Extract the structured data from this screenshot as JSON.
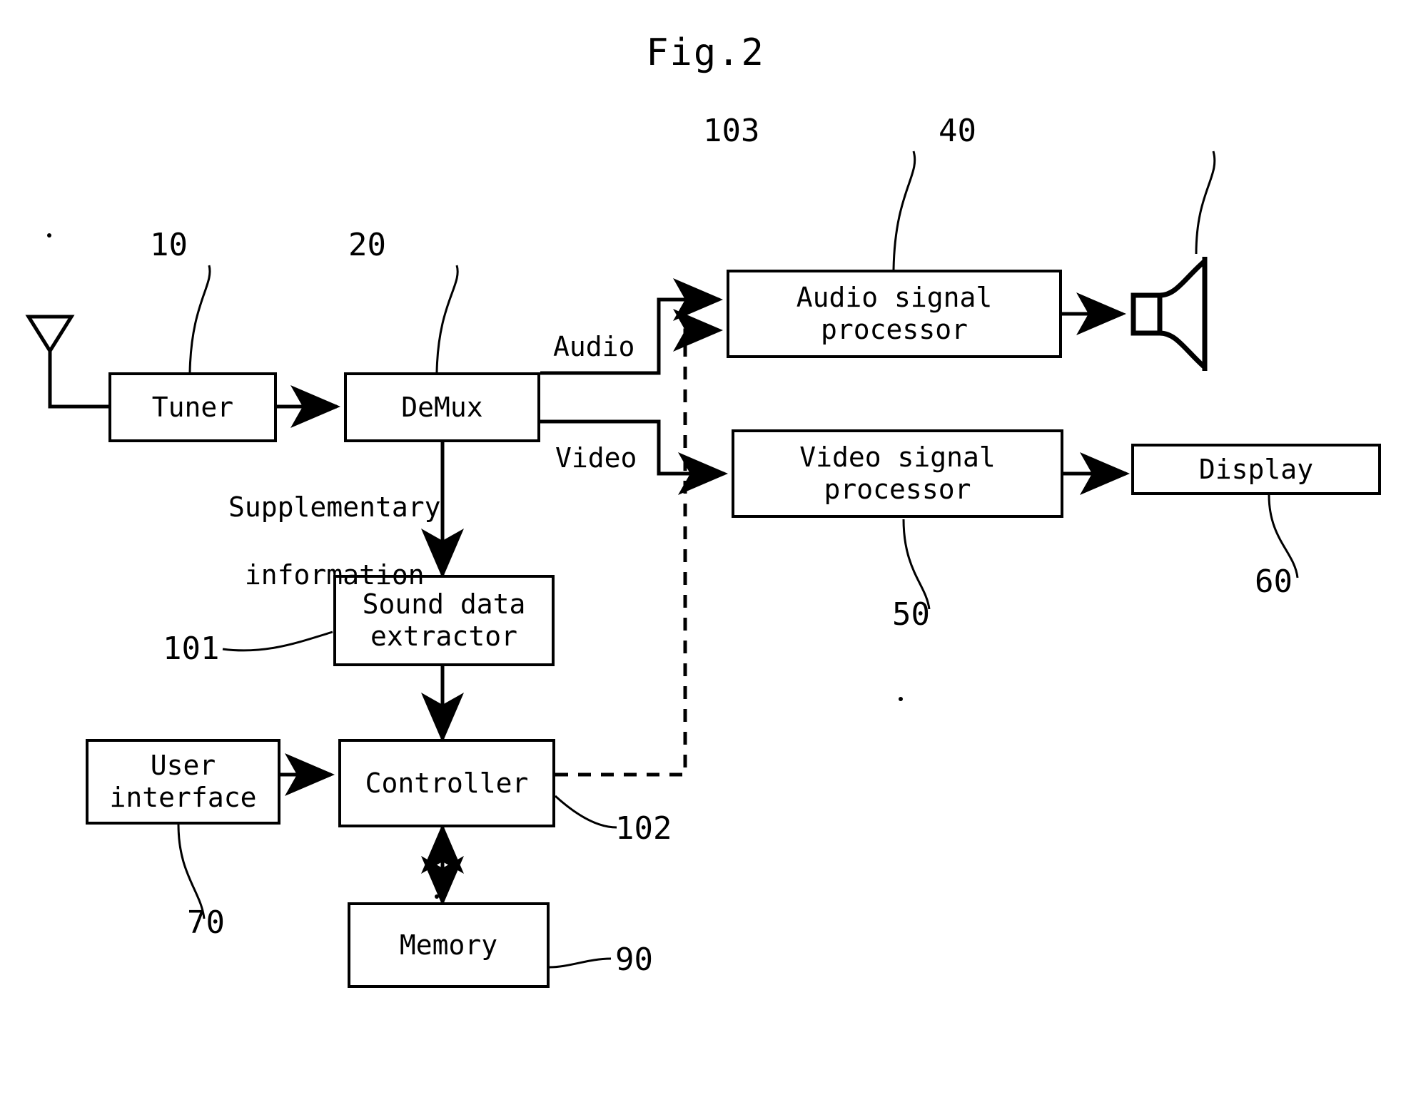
{
  "figure": {
    "title": "Fig.2",
    "type": "block-diagram",
    "domain": "patent-drawing",
    "ink_color": "#000000",
    "background_color": "#ffffff"
  },
  "blocks": [
    {
      "id": "tuner",
      "label": "Tuner",
      "ref": "10"
    },
    {
      "id": "demux",
      "label": "DeMux",
      "ref": "20"
    },
    {
      "id": "audio_proc",
      "label": "Audio signal\nprocessor",
      "ref": "103"
    },
    {
      "id": "video_proc",
      "label": "Video signal\nprocessor",
      "ref": "50"
    },
    {
      "id": "display",
      "label": "Display",
      "ref": "60"
    },
    {
      "id": "sound_ext",
      "label": "Sound data\nextractor",
      "ref": "101"
    },
    {
      "id": "controller",
      "label": "Controller",
      "ref": "102"
    },
    {
      "id": "user_if",
      "label": "User\ninterface",
      "ref": "70"
    },
    {
      "id": "memory",
      "label": "Memory",
      "ref": "90"
    }
  ],
  "box_labels": {
    "tuner": "Tuner",
    "demux": "DeMux",
    "audio_proc_line1": "Audio signal",
    "audio_proc_line2": "processor",
    "video_proc_line1": "Video signal",
    "video_proc_line2": "processor",
    "display": "Display",
    "sound_ext_line1": "Sound data",
    "sound_ext_line2": "extractor",
    "controller": "Controller",
    "user_if_line1": "User",
    "user_if_line2": "interface",
    "memory": "Memory"
  },
  "icons": [
    {
      "id": "antenna",
      "name": "antenna-icon",
      "ref": null
    },
    {
      "id": "speaker",
      "name": "speaker-icon",
      "ref": "40"
    }
  ],
  "reference_numerals": {
    "tuner": "10",
    "demux": "20",
    "audio_processor": "103",
    "speaker": "40",
    "video_processor": "50",
    "display": "60",
    "sound_data_extractor": "101",
    "controller": "102",
    "user_interface": "70",
    "memory": "90"
  },
  "edge_labels": {
    "audio": "Audio",
    "video": "Video",
    "supplementary_line1": "Supplementary",
    "supplementary_line2": "information"
  },
  "connections": [
    {
      "from": "antenna",
      "to": "tuner",
      "style": "solid",
      "arrow": "none"
    },
    {
      "from": "tuner",
      "to": "demux",
      "style": "solid",
      "arrow": "end",
      "label": ""
    },
    {
      "from": "demux",
      "to": "audio_proc",
      "style": "solid",
      "arrow": "end",
      "label": "Audio"
    },
    {
      "from": "demux",
      "to": "video_proc",
      "style": "solid",
      "arrow": "end",
      "label": "Video"
    },
    {
      "from": "demux",
      "to": "sound_ext",
      "style": "solid",
      "arrow": "end",
      "label": "Supplementary information"
    },
    {
      "from": "audio_proc",
      "to": "speaker",
      "style": "solid",
      "arrow": "end",
      "label": ""
    },
    {
      "from": "video_proc",
      "to": "display",
      "style": "solid",
      "arrow": "end",
      "label": ""
    },
    {
      "from": "sound_ext",
      "to": "controller",
      "style": "solid",
      "arrow": "end",
      "label": ""
    },
    {
      "from": "user_if",
      "to": "controller",
      "style": "solid",
      "arrow": "end",
      "label": ""
    },
    {
      "from": "controller",
      "to": "memory",
      "style": "solid",
      "arrow": "both",
      "label": ""
    },
    {
      "from": "controller",
      "to": "audio_proc",
      "style": "dashed",
      "arrow": "end",
      "label": ""
    }
  ]
}
